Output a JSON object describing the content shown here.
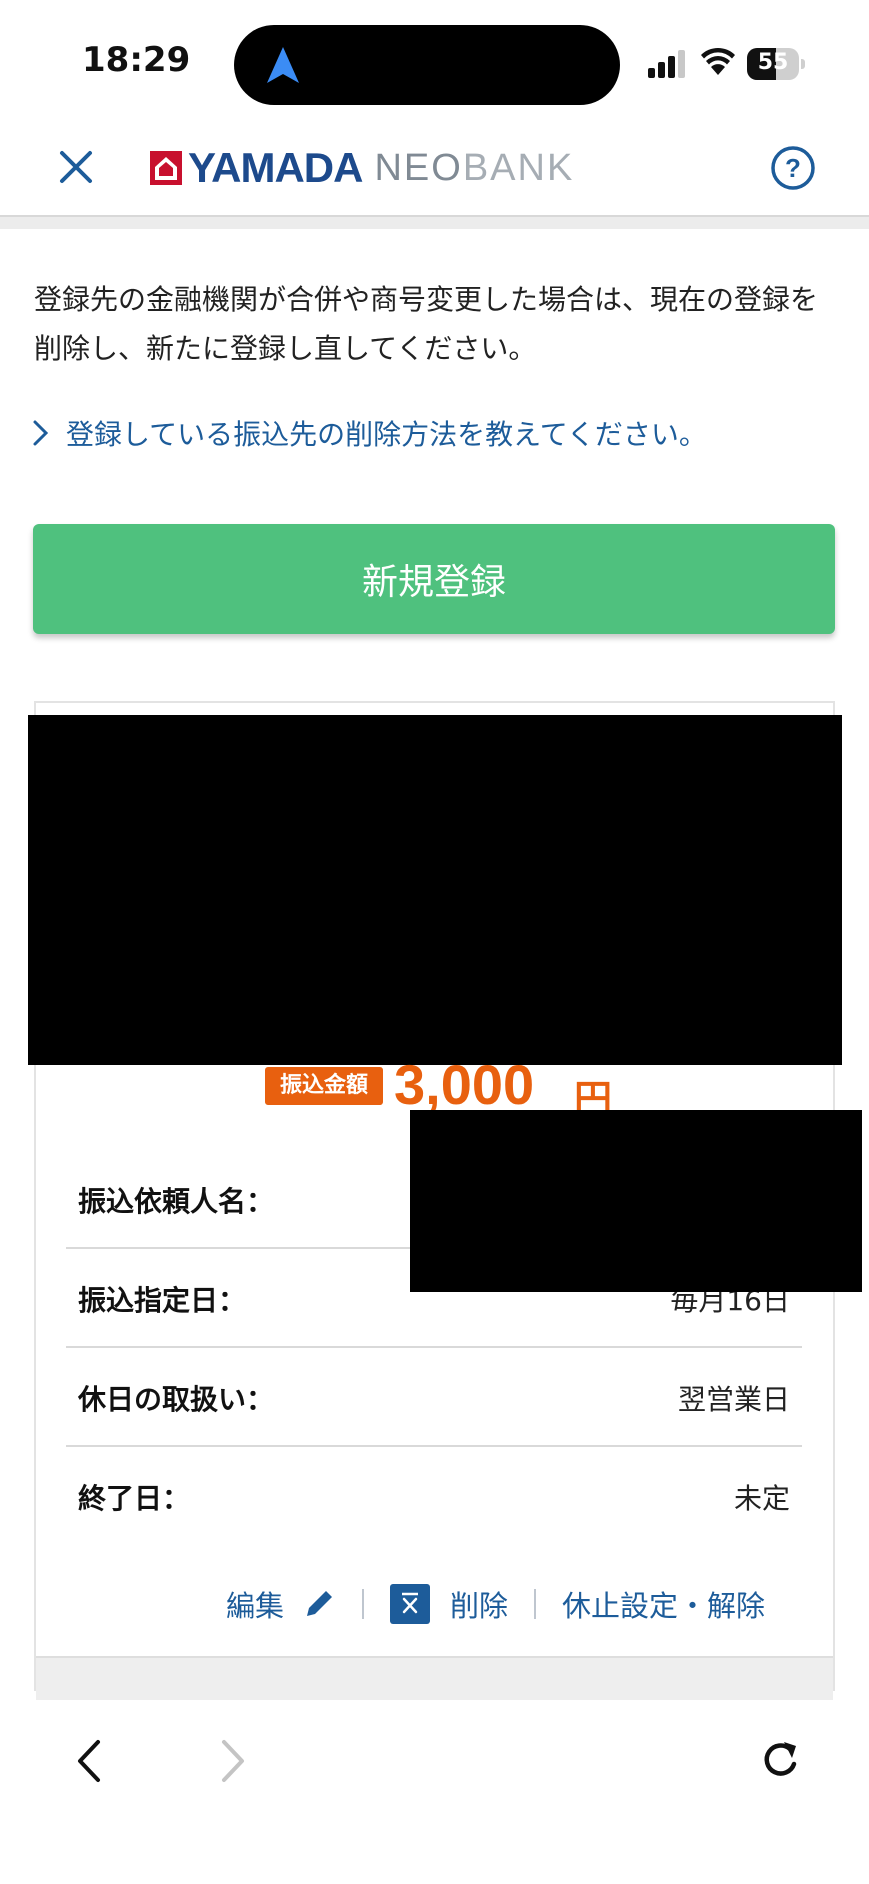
{
  "status_bar": {
    "time": "18:29",
    "battery": "55",
    "battery_level": 0.55
  },
  "header": {
    "logo_yamada": "YAMADA",
    "logo_neo": "NEO",
    "logo_bank": "BANK",
    "close_icon": "close-icon",
    "help_icon": "help-icon"
  },
  "notice": {
    "text": "登録先の金融機関が合併や商号変更した場合は、現在の登録を削除し、新たに登録し直してください。"
  },
  "faq": {
    "link_text": "登録している振込先の削除方法を教えてください。"
  },
  "register_button": {
    "label": "新規登録"
  },
  "transfer": {
    "amount_badge": "振込金額",
    "amount": "3,000",
    "unit": "円",
    "rows": [
      {
        "label": "振込依頼人名：",
        "value": ""
      },
      {
        "label": "振込指定日：",
        "value": "毎月16日"
      },
      {
        "label": "休日の取扱い：",
        "value": "翌営業日"
      },
      {
        "label": "終了日：",
        "value": "未定"
      }
    ],
    "actions": {
      "edit": "編集",
      "delete": "削除",
      "suspend": "休止設定・解除"
    }
  },
  "colors": {
    "accent_green": "#4fc17e",
    "link_blue": "#1d5c9a",
    "amount_orange": "#e8600f",
    "brand_red": "#c8102e"
  }
}
